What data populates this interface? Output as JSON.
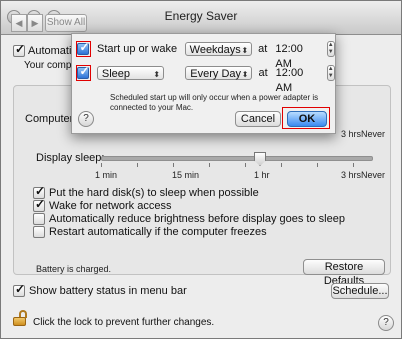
{
  "window": {
    "title": "Energy Saver",
    "show_all_label": "Show All",
    "back_label": "◀",
    "forward_label": "▶"
  },
  "background": {
    "auto_graphics_label": "Automatic g",
    "auto_graphics_sub": "Your compute",
    "computer_sleep_label": "Computer s",
    "display_sleep_label": "Display sleep:",
    "slider_labels": [
      "1 min",
      "15 min",
      "1 hr",
      "3 hrs",
      "Never"
    ],
    "computer_sleep_end_labels": [
      "3 hrs",
      "Never"
    ],
    "options": [
      {
        "label": "Put the hard disk(s) to sleep when possible",
        "checked": true
      },
      {
        "label": "Wake for network access",
        "checked": true
      },
      {
        "label": "Automatically reduce brightness before display goes to sleep",
        "checked": false
      },
      {
        "label": "Restart automatically if the computer freezes",
        "checked": false
      }
    ],
    "battery_status": "Battery is charged.",
    "restore_defaults_label": "Restore Defaults",
    "show_battery_label": "Show battery status in menu bar",
    "schedule_label": "Schedule...",
    "lock_text": "Click the lock to prevent further changes.",
    "help_label": "?"
  },
  "sheet": {
    "row1": {
      "label": "Start up or wake",
      "checked": true,
      "day": "Weekdays",
      "at_label": "at",
      "time": "12:00 AM"
    },
    "row2": {
      "action": "Sleep",
      "checked": true,
      "day": "Every Day",
      "at_label": "at",
      "time": "12:00 AM"
    },
    "note_line1": "Scheduled start up will only occur when a power adapter is",
    "note_line2": "connected to your Mac.",
    "cancel_label": "Cancel",
    "ok_label": "OK",
    "help_label": "?",
    "highlight_color": "#e10000"
  }
}
